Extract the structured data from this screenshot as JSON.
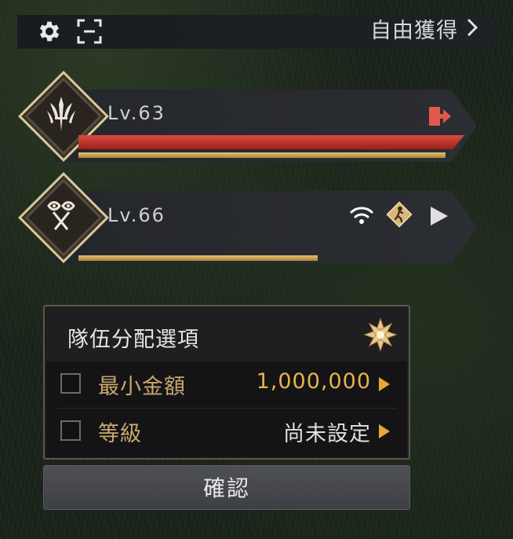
{
  "topbar": {
    "settings_icon": "gear-icon",
    "screenshot_icon": "screen-capture-icon",
    "free_gain_label": "自由獲得",
    "free_gain_icon": "chevron-right-icon"
  },
  "party": {
    "members": [
      {
        "level_text": "Lv.63",
        "class_icon": "class-emblem-icon",
        "hp_fraction": 1.0,
        "hp_color": "#c8312d",
        "resource_fraction": 1.0,
        "resource_color": "#c9a24a",
        "action_icon": "leave-party-icon"
      },
      {
        "level_text": "Lv.66",
        "class_icon": "class-emblem-icon",
        "resource_fraction": 0.62,
        "resource_color": "#c9a24a",
        "status_icons": [
          "wifi-signal-icon",
          "follow-run-icon",
          "play-arrow-icon"
        ]
      }
    ]
  },
  "options_panel": {
    "title": "隊伍分配選項",
    "badge_icon": "flower-badge-icon",
    "rows": [
      {
        "label": "最小金額",
        "value": "1,000,000",
        "value_color": "#e6b44a",
        "checked": false
      },
      {
        "label": "等級",
        "value": "尚未設定",
        "value_color": "#e0e0e0",
        "checked": false
      }
    ]
  },
  "confirm_label": "確認"
}
